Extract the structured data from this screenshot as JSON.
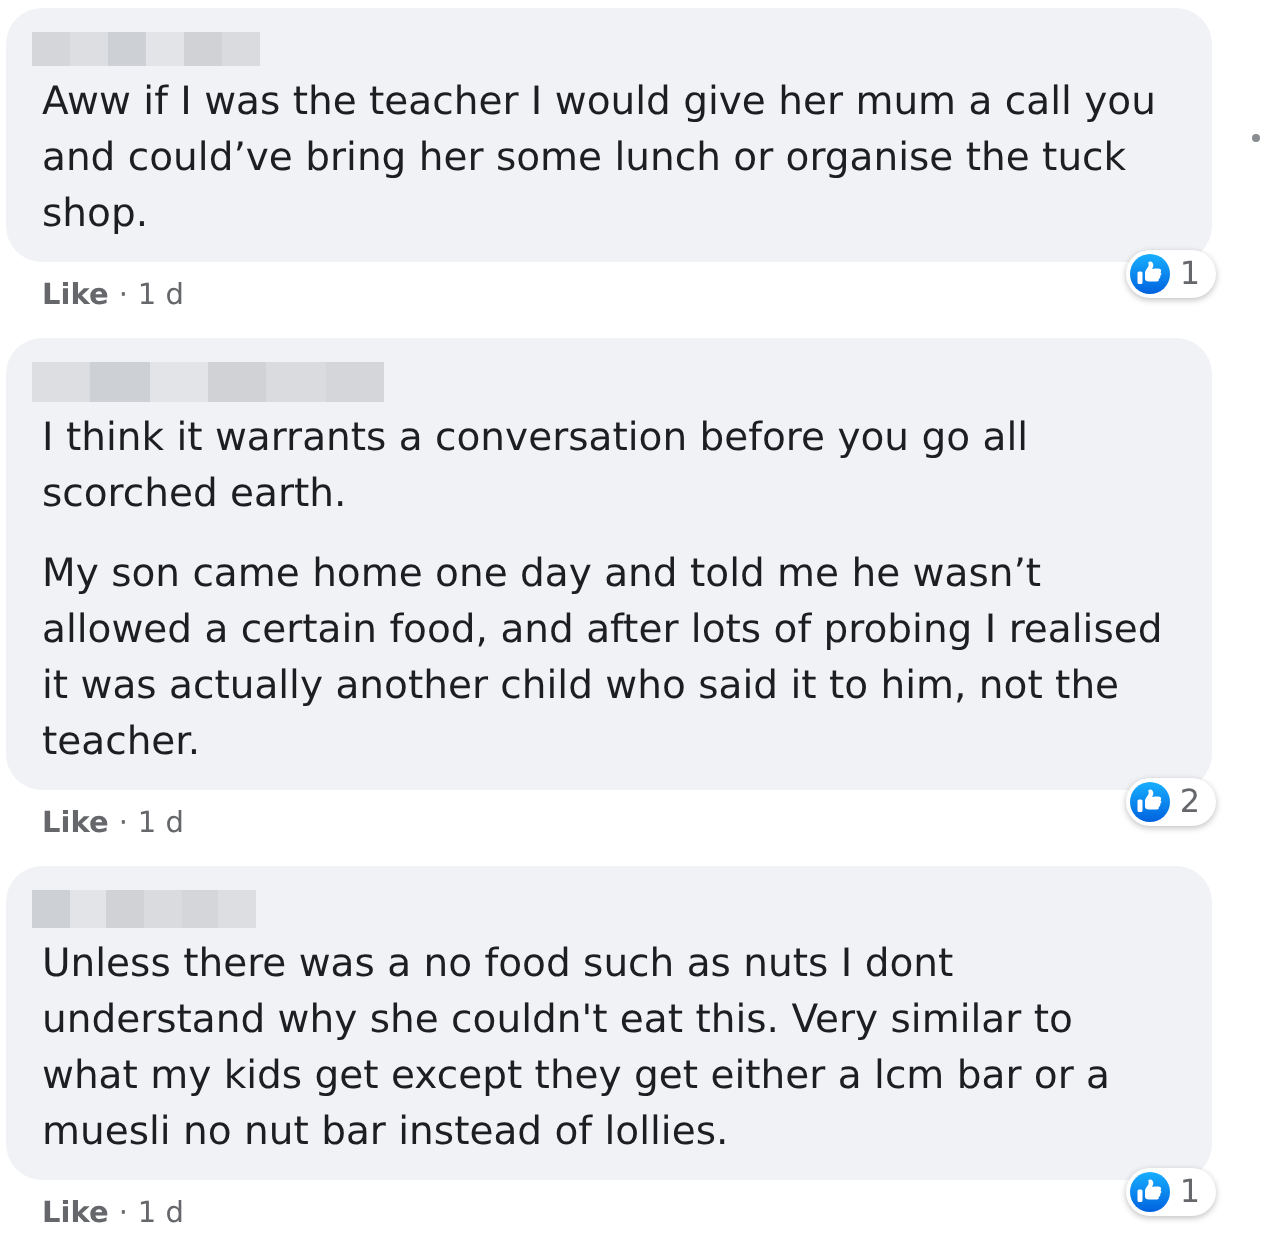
{
  "comments": [
    {
      "author": {
        "kind": "blurred"
      },
      "paragraphs": [
        "Aww if I was the teacher I would give her mum a call you and could’ve bring her some lunch or organise the tuck shop."
      ],
      "reactions": {
        "count": "1"
      },
      "like_label": "Like",
      "separator": "·",
      "time": "1 d",
      "options_dot": true
    },
    {
      "author": {
        "kind": "blurred"
      },
      "paragraphs": [
        "I think it warrants a conversation before you go all scorched earth.",
        "My son came home one day and told me he wasn’t allowed a certain food, and after lots of probing I realised it was actually another child who said it to him, not the teacher."
      ],
      "reactions": {
        "count": "2"
      },
      "like_label": "Like",
      "separator": "·",
      "time": "1 d",
      "options_dot": false
    },
    {
      "author": {
        "kind": "blurred"
      },
      "paragraphs": [
        "Unless there was a no food such as nuts I dont understand why she couldn't eat this. Very similar to what my kids get except they get either a lcm bar or a muesli no nut bar instead of lollies."
      ],
      "reactions": {
        "count": "1"
      },
      "like_label": "Like",
      "separator": "·",
      "time": "1 d",
      "options_dot": false
    }
  ]
}
